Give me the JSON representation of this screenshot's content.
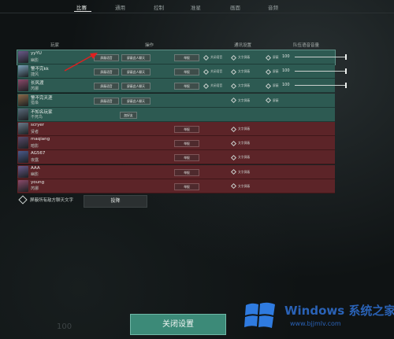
{
  "tabs": [
    {
      "label": "比赛",
      "active": true
    },
    {
      "label": "通用",
      "active": false
    },
    {
      "label": "控制",
      "active": false
    },
    {
      "label": "准星",
      "active": false
    },
    {
      "label": "画面",
      "active": false
    },
    {
      "label": "音频",
      "active": false
    }
  ],
  "columns": {
    "player": "玩家",
    "actions": "操作",
    "comm": "通讯设置",
    "volume": "队伍语音音量"
  },
  "action_labels": {
    "report": "屏蔽语音",
    "block_text": "屏蔽此人聊天",
    "add_friend": "加好友",
    "report_btn": "举报",
    "voice_mute": "关闭语音",
    "text_mute": "文字屏蔽",
    "block": "屏蔽"
  },
  "players": [
    {
      "name": "yyYU",
      "agent": "幽影",
      "team": "ally",
      "self": true,
      "volume": "100",
      "color": "#6b5a8a"
    },
    {
      "name": "警不完kk",
      "agent": "捷风",
      "team": "ally",
      "volume": "100",
      "color": "#7aa0b8"
    },
    {
      "name": "长风渡",
      "agent": "芮娜",
      "team": "ally",
      "volume": "100",
      "color": "#8b4a6b"
    },
    {
      "name": "警不完天涯",
      "agent": "猎枭",
      "team": "ally",
      "color": "#8a6a4a"
    },
    {
      "name": "不知名玩家",
      "agent": "不死鸟",
      "team": "ally",
      "color": "#5a6a7a"
    },
    {
      "name": "scryer",
      "agent": "贤者",
      "team": "enemy",
      "color": "#6a7a8a"
    },
    {
      "name": "maqiang",
      "agent": "暗影",
      "team": "enemy",
      "color": "#5a4a6a"
    },
    {
      "name": "AG567",
      "agent": "夜露",
      "team": "enemy",
      "color": "#4a5a8a"
    },
    {
      "name": "AAA",
      "agent": "幽影",
      "team": "enemy",
      "color": "#6a5a8a"
    },
    {
      "name": "young",
      "agent": "芮娜",
      "team": "enemy",
      "color": "#8a4a6a"
    }
  ],
  "text_toggle_label": "屏蔽所有敌方聊天文字",
  "surrender_label": "投降",
  "close_label": "关闭设置",
  "faded_number": "100",
  "watermark": {
    "title": "Windows 系统之家",
    "url": "www.bjjmlv.com"
  }
}
